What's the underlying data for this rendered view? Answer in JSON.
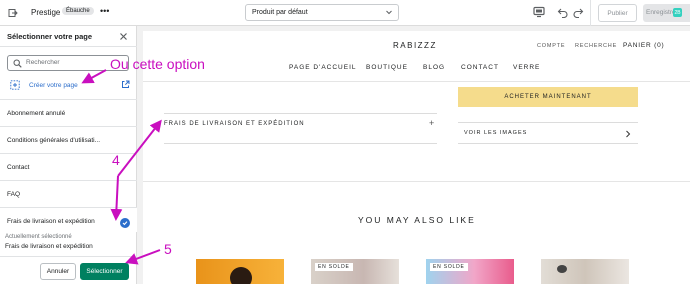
{
  "topbar": {
    "theme_name": "Prestige",
    "status_badge": "Ébauche",
    "more": "•••",
    "template_select": "Produit par défaut",
    "publish_label": "Publier",
    "save_label": "Enregistrer",
    "badge_glyph": "2B"
  },
  "sidebar": {
    "title": "Sélectionner votre page",
    "search_placeholder": "Rechercher",
    "create_label": "Créer votre page",
    "items": [
      {
        "label": "Abonnement annulé"
      },
      {
        "label": "Conditions générales d'utilisati..."
      },
      {
        "label": "Contact"
      },
      {
        "label": "FAQ"
      },
      {
        "label": "Frais de livraison et expédition"
      }
    ],
    "current_label": "Actuellement sélectionné",
    "current_value": "Frais de livraison et expédition",
    "cancel_label": "Annuler",
    "select_label": "Sélectionner"
  },
  "preview": {
    "store_name": "RABIZZZ",
    "header_links": [
      "COMPTE",
      "RECHERCHE",
      "PANIER (0)"
    ],
    "nav": [
      "PAGE D'ACCUEIL",
      "BOUTIQUE",
      "BLOG",
      "CONTACT",
      "VERRE"
    ],
    "buy_now": "ACHETER MAINTENANT",
    "accordion_title": "FRAIS DE LIVRAISON ET EXPÉDITION",
    "accordion_icon": "+",
    "view_images": "VOIR LES IMAGES",
    "section_title": "YOU MAY ALSO LIKE",
    "sale_badge": "EN SOLDE"
  },
  "annotations": {
    "option_text": "Ou cette option",
    "step4": "4",
    "step5": "5",
    "color": "#c90fbf"
  },
  "colors": {
    "accent_blue": "#2c6ecb",
    "primary_green": "#008060",
    "buy_yellow": "#f5dc8c"
  }
}
